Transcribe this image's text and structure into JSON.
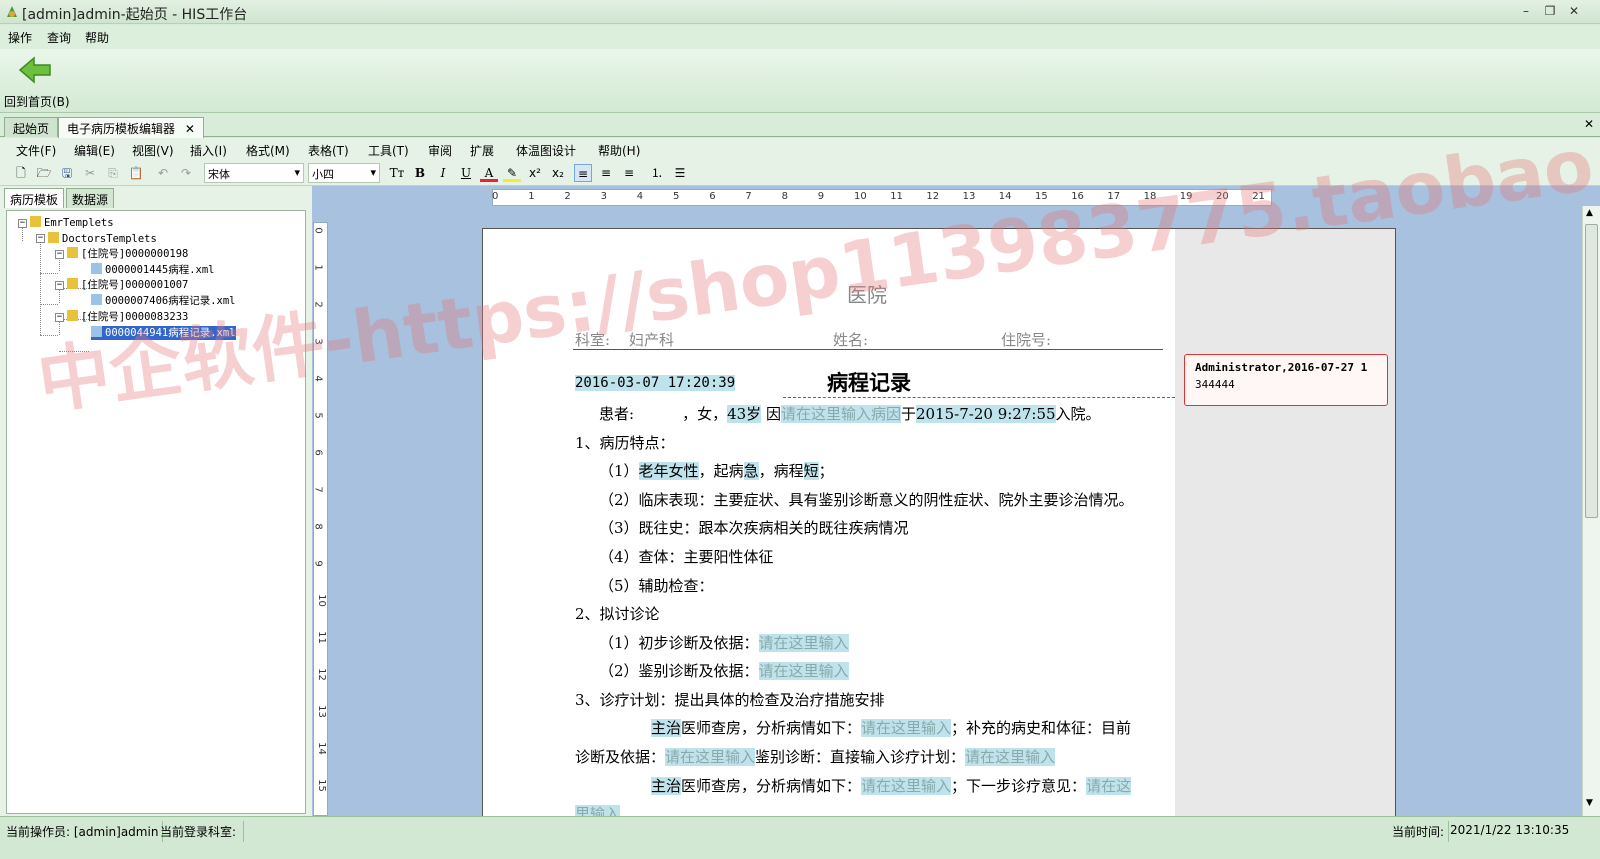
{
  "window": {
    "title": "[admin]admin-起始页 - HIS工作台",
    "controls": [
      "minimize-icon",
      "restore-icon",
      "close-icon"
    ]
  },
  "menubar": [
    "操作",
    "查询",
    "帮助"
  ],
  "toolbar": {
    "home_label": "回到首页(B)"
  },
  "tabs": [
    {
      "label": "起始页"
    },
    {
      "label": "电子病历模板编辑器"
    }
  ],
  "editor_menu": [
    "文件(F)",
    "编辑(E)",
    "视图(V)",
    "插入(I)",
    "格式(M)",
    "表格(T)",
    "工具(T)",
    "审阅",
    "扩展",
    "体温图设计",
    "帮助(H)"
  ],
  "editor_toolbar": {
    "font": "宋体",
    "size": "小四"
  },
  "left_panel": {
    "tabs": [
      "病历模板",
      "数据源"
    ],
    "tree": [
      {
        "label": "EmrTemplets"
      },
      {
        "label": "DoctorsTemplets"
      },
      {
        "label": "[住院号]0000000198"
      },
      {
        "label": "0000001445病程.xml"
      },
      {
        "label": "[住院号]0000001007"
      },
      {
        "label": "0000007406病程记录.xml"
      },
      {
        "label": "[住院号]0000083233"
      },
      {
        "label": "0000044941病程记录.xml"
      }
    ]
  },
  "ruler": {
    "h": [
      "0",
      "1",
      "2",
      "3",
      "4",
      "5",
      "6",
      "7",
      "8",
      "9",
      "10",
      "11",
      "12",
      "13",
      "14",
      "15",
      "16",
      "17",
      "18",
      "19",
      "20",
      "21"
    ],
    "v": [
      "0",
      "1",
      "2",
      "3",
      "4",
      "5",
      "6",
      "7",
      "8",
      "9",
      "10",
      "11",
      "12",
      "13",
      "14",
      "15"
    ]
  },
  "doc": {
    "hospital": "医院",
    "dept_label": "科室:",
    "dept_value": "妇产科",
    "name_label": "姓名:",
    "inpatient_label": "住院号:",
    "datetime": "2016-03-07 17:20:39",
    "title": "病程记录",
    "l1_a": "患者:",
    "l1_b": "，女，",
    "l1_age": "43岁",
    "l1_c": "因",
    "l1_reason": "请在这里输入病因",
    "l1_d": "于",
    "l1_date": "2015-7-20 9:27:55",
    "l1_e": "入院。",
    "s1": "1、病历特点：",
    "s1_1a": "（1）",
    "s1_1b": "老年女性",
    "s1_1c": "，起病",
    "s1_1d": "急",
    "s1_1e": "，病程",
    "s1_1f": "短",
    "s1_1g": "；",
    "s1_2": "（2）临床表现：主要症状、具有鉴别诊断意义的阴性症状、院外主要诊治情况。",
    "s1_3": "（3）既往史：跟本次疾病相关的既往疾病情况",
    "s1_4": "（4）查体：主要阳性体征",
    "s1_5": "（5）辅助检查：",
    "s2": "2、拟讨诊论",
    "s2_1a": "（1）初步诊断及依据：",
    "s2_2a": "（2）鉴别诊断及依据：",
    "ph": "请在这里输入",
    "s3": "3、诊疗计划：提出具体的检查及治疗措施安排",
    "p1a": "主治",
    "p1b": "医师查房，分析病情如下：",
    "p1c": "；补充的病史和体征：目前",
    "p2a": "诊断及依据：",
    "p2b": "鉴别诊断：直接输入诊疗计划：",
    "p3c": "；下一步诊疗意见：",
    "p3d": "请在这",
    "p4": "里输入"
  },
  "comment": {
    "author": "Administrator,2016-07-27 1",
    "text": "344444"
  },
  "watermark": "中企软件-https://shop113983775.taobao.com",
  "status": {
    "operator": "当前操作员: [admin]admin",
    "dept": "当前登录科室:",
    "time_label": "当前时间:",
    "time": "2021/1/22 13:10:35"
  }
}
